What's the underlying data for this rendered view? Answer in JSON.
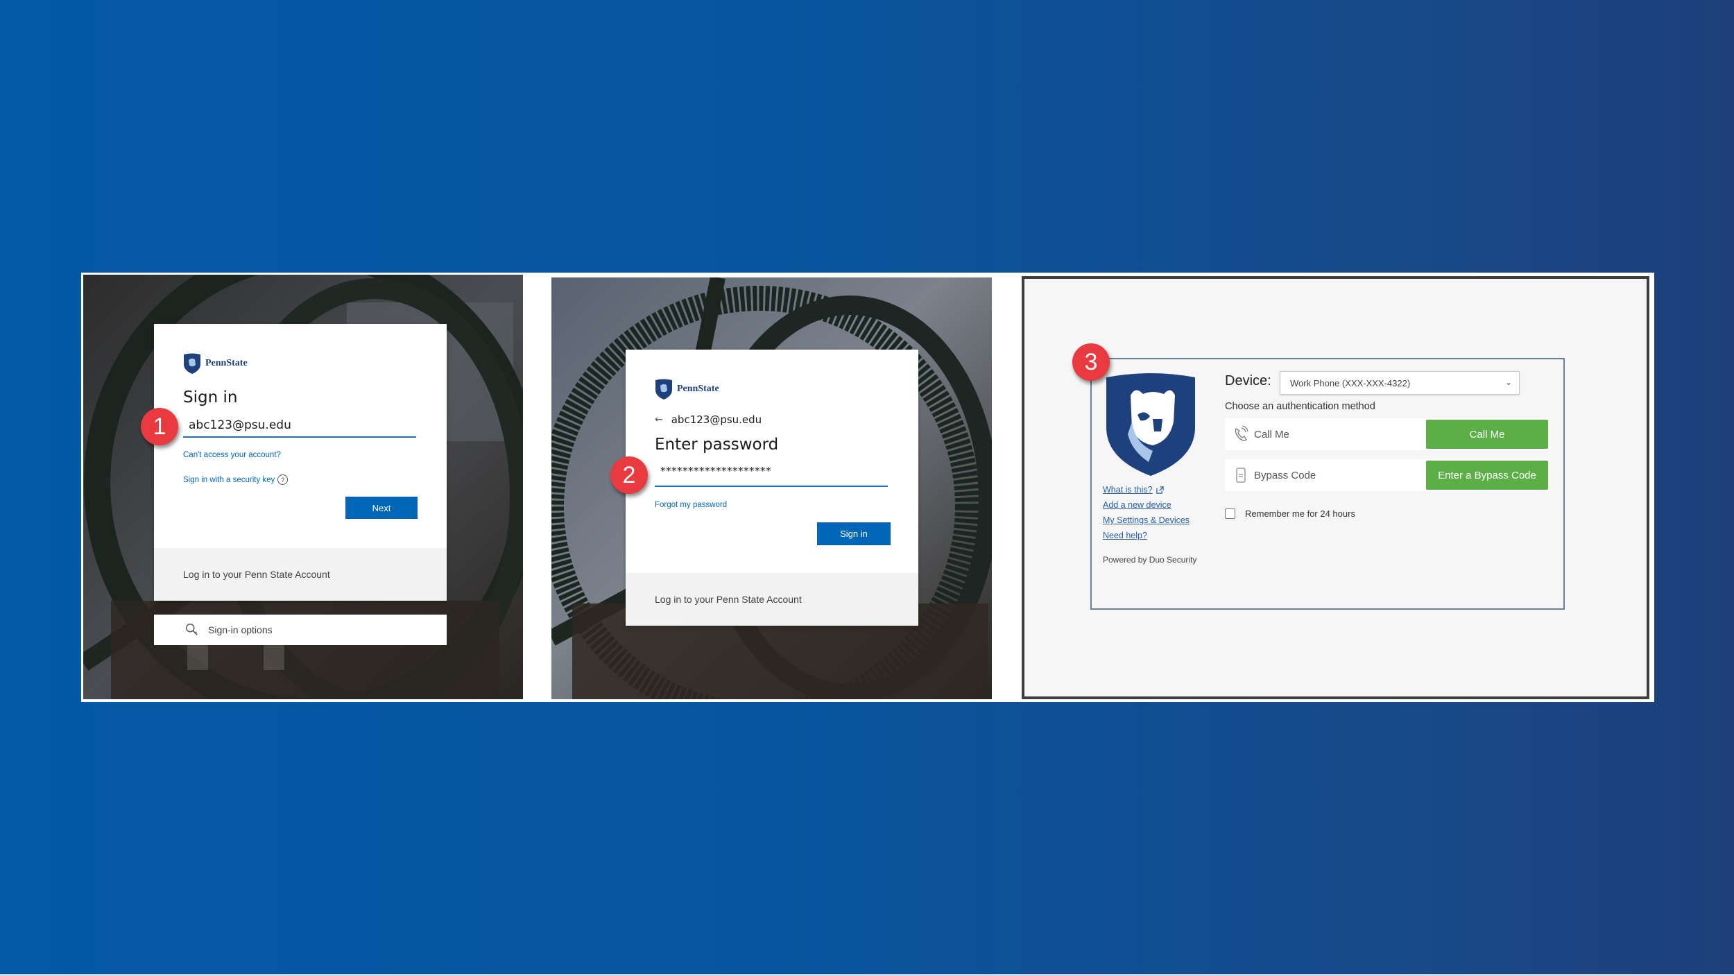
{
  "colors": {
    "background_left": "#0359a6",
    "background_right": "#1e3f7a",
    "microsoft_blue": "#0067b8",
    "penn_state_navy": "#1e407c",
    "badge_red": "#e83a3f",
    "duo_green": "#5cae47"
  },
  "step1": {
    "badge": "1",
    "brand": "PennState",
    "title": "Sign in",
    "email_value": "abc123@psu.edu",
    "cant_access_link": "Can't access your account?",
    "security_key_link": "Sign in with a security key",
    "help_icon": "?",
    "next_button": "Next",
    "footer_text": "Log in to your Penn State Account",
    "signin_options": "Sign-in options"
  },
  "step2": {
    "badge": "2",
    "brand": "PennState",
    "back_arrow": "←",
    "email_display": "abc123@psu.edu",
    "title": "Enter password",
    "password_value": "********************",
    "forgot_link": "Forgot my password",
    "signin_button": "Sign in",
    "footer_text": "Log in to your Penn State Account"
  },
  "step3": {
    "badge": "3",
    "device_label": "Device:",
    "device_selected": "Work Phone (XXX-XXX-4322)",
    "choose_text": "Choose an authentication method",
    "methods": [
      {
        "label": "Call Me",
        "button": "Call Me",
        "icon": "phone-call-icon"
      },
      {
        "label": "Bypass Code",
        "button": "Enter a Bypass Code",
        "icon": "bypass-code-icon"
      }
    ],
    "remember_label": "Remember me for 24 hours",
    "remember_checked": false,
    "links": [
      "What is this?",
      "Add a new device",
      "My Settings & Devices",
      "Need help?"
    ],
    "powered_by": "Powered by Duo Security"
  }
}
